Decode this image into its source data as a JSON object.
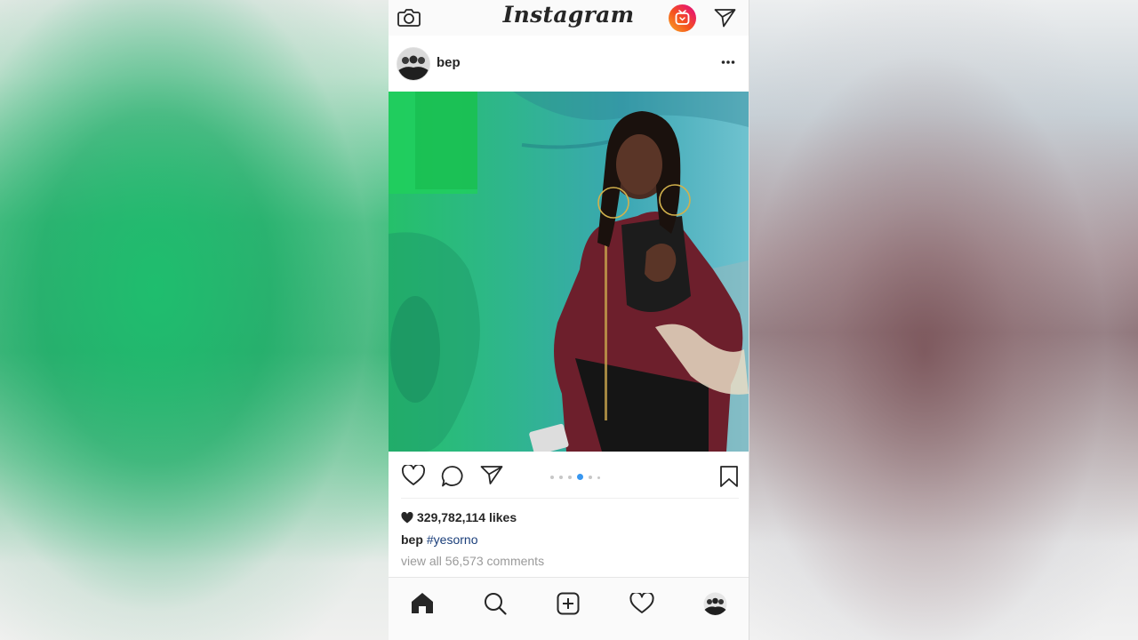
{
  "app": {
    "logo_text": "Instagram"
  },
  "top_bar": {
    "camera_icon": "camera-icon",
    "igtv_icon": "igtv-icon",
    "direct_icon": "paper-plane-icon"
  },
  "post": {
    "username": "bep",
    "more_icon": "more-options-icon",
    "carousel": {
      "total": 6,
      "active_index": 3
    },
    "likes": "329,782,114 likes",
    "caption_user": "bep",
    "caption_text": "#yesorno",
    "comments_link": "view all 56,573 comments"
  },
  "bottom_nav": {
    "items": [
      "home-icon",
      "search-icon",
      "new-post-icon",
      "activity-heart-icon",
      "profile-avatar"
    ]
  },
  "colors": {
    "accent_blue": "#3897f0",
    "hashtag": "#1a3e7a",
    "text": "#262626",
    "muted": "#9a9a9a"
  }
}
